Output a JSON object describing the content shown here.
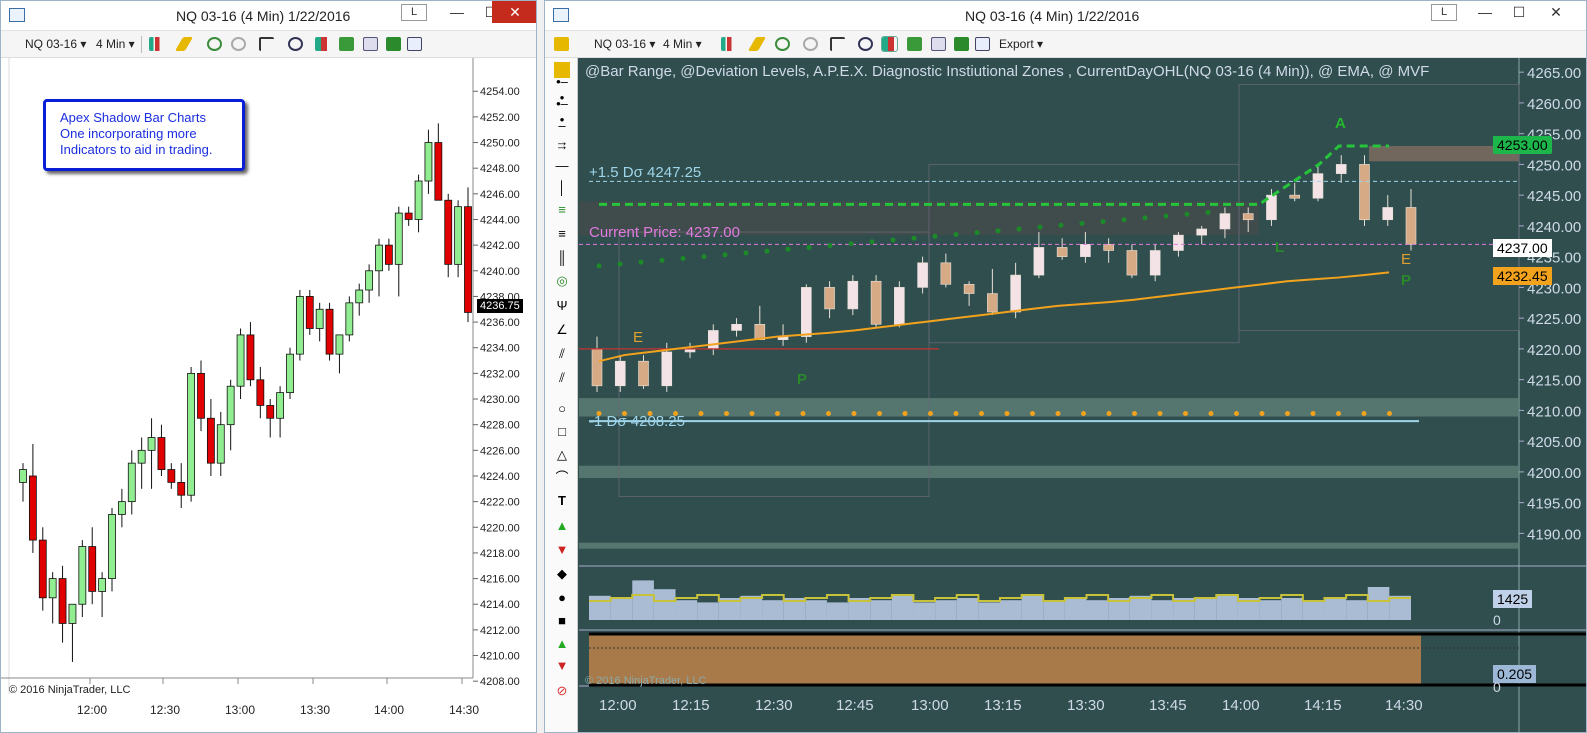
{
  "left_window": {
    "title": "NQ 03-16 (4 Min)  1/22/2016",
    "l_button": "L",
    "min_glyph": "—",
    "max_glyph": "☐",
    "close_glyph": "✕",
    "instrument": "NQ 03-16",
    "interval": "4 Min",
    "callout": [
      "Apex Shadow Bar Charts",
      "One incorporating more",
      "Indicators to aid in trading."
    ],
    "price_label": "4236.75",
    "copyright": "© 2016 NinjaTrader, LLC",
    "y_ticks": [
      "4254.00",
      "4252.00",
      "4250.00",
      "4248.00",
      "4246.00",
      "4244.00",
      "4242.00",
      "4240.00",
      "4238.00",
      "4236.00",
      "4234.00",
      "4232.00",
      "4230.00",
      "4228.00",
      "4226.00",
      "4224.00",
      "4222.00",
      "4220.00",
      "4218.00",
      "4216.00",
      "4214.00",
      "4212.00",
      "4210.00",
      "4208.00"
    ],
    "x_ticks": [
      "12:00",
      "12:30",
      "13:00",
      "13:30",
      "14:00",
      "14:30"
    ]
  },
  "right_window": {
    "title": "NQ 03-16 (4 Min)  1/22/2016",
    "l_button": "L",
    "min_glyph": "—",
    "max_glyph": "☐",
    "close_glyph": "✕",
    "instrument": "NQ 03-16",
    "interval": "4 Min",
    "export_label": "Export",
    "indicators_line": "@Bar Range, @Deviation Levels, A.P.E.X. Diagnostic Instiutional Zones , CurrentDayOHL(NQ 03-16 (4 Min)), @ EMA, @ MVF",
    "upper_dev_label": "+1.5 Dσ 4247.25",
    "lower_dev_label": "-1 Dσ 4208.25",
    "current_price_label": "Current Price: 4237.00",
    "y_ticks": [
      "4265.00",
      "4260.00",
      "4255.00",
      "4250.00",
      "4245.00",
      "4240.00",
      "4235.00",
      "4230.00",
      "4225.00",
      "4220.00",
      "4215.00",
      "4210.00",
      "4205.00",
      "4200.00",
      "4195.00",
      "4190.00"
    ],
    "x_ticks": [
      "12:00",
      "12:15",
      "12:30",
      "12:45",
      "13:00",
      "13:15",
      "13:30",
      "13:45",
      "14:00",
      "14:15",
      "14:30"
    ],
    "price_boxes": [
      "4253.00",
      "4237.00",
      "4232.45"
    ],
    "volume_box": "1425",
    "volume_zero": "0",
    "osc_box": "0.205",
    "osc_zero": "0",
    "copyright": "© 2016 NinjaTrader, LLC",
    "markers": {
      "A": "A",
      "E": "E",
      "P": "P",
      "L": "L"
    }
  },
  "left_chart_data": {
    "type": "candlestick",
    "ylim": [
      4207,
      4255.5
    ],
    "candles": [
      {
        "o": 4223.5,
        "h": 4225,
        "l": 4222,
        "c": 4224.5
      },
      {
        "o": 4224,
        "h": 4226.5,
        "l": 4218,
        "c": 4219
      },
      {
        "o": 4219,
        "h": 4220,
        "l": 4213.5,
        "c": 4214.5
      },
      {
        "o": 4214.5,
        "h": 4216.5,
        "l": 4212.5,
        "c": 4216
      },
      {
        "o": 4216,
        "h": 4217,
        "l": 4211,
        "c": 4212.5
      },
      {
        "o": 4212.5,
        "h": 4214,
        "l": 4209.5,
        "c": 4214
      },
      {
        "o": 4214,
        "h": 4219,
        "l": 4213,
        "c": 4218.5
      },
      {
        "o": 4218.5,
        "h": 4220,
        "l": 4214,
        "c": 4215
      },
      {
        "o": 4215,
        "h": 4216.5,
        "l": 4213,
        "c": 4216
      },
      {
        "o": 4216,
        "h": 4221.5,
        "l": 4215,
        "c": 4221
      },
      {
        "o": 4221,
        "h": 4223,
        "l": 4220,
        "c": 4222
      },
      {
        "o": 4222,
        "h": 4226,
        "l": 4221,
        "c": 4225
      },
      {
        "o": 4225,
        "h": 4227,
        "l": 4223,
        "c": 4226
      },
      {
        "o": 4226,
        "h": 4228.5,
        "l": 4223,
        "c": 4227
      },
      {
        "o": 4227,
        "h": 4228,
        "l": 4224,
        "c": 4224.5
      },
      {
        "o": 4224.5,
        "h": 4225,
        "l": 4223,
        "c": 4223.5
      },
      {
        "o": 4223.5,
        "h": 4225,
        "l": 4221.5,
        "c": 4222.5
      },
      {
        "o": 4222.5,
        "h": 4232.5,
        "l": 4222,
        "c": 4232
      },
      {
        "o": 4232,
        "h": 4233,
        "l": 4227.5,
        "c": 4228.5
      },
      {
        "o": 4228.5,
        "h": 4230,
        "l": 4224,
        "c": 4225
      },
      {
        "o": 4225,
        "h": 4229,
        "l": 4224,
        "c": 4228
      },
      {
        "o": 4228,
        "h": 4231.5,
        "l": 4226,
        "c": 4231
      },
      {
        "o": 4231,
        "h": 4235.5,
        "l": 4230,
        "c": 4235
      },
      {
        "o": 4235,
        "h": 4236,
        "l": 4231,
        "c": 4231.5
      },
      {
        "o": 4231.5,
        "h": 4232.5,
        "l": 4228.5,
        "c": 4229.5
      },
      {
        "o": 4229.5,
        "h": 4230,
        "l": 4227,
        "c": 4228.5
      },
      {
        "o": 4228.5,
        "h": 4231,
        "l": 4227,
        "c": 4230.5
      },
      {
        "o": 4230.5,
        "h": 4234,
        "l": 4230,
        "c": 4233.5
      },
      {
        "o": 4233.5,
        "h": 4238.5,
        "l": 4233,
        "c": 4238
      },
      {
        "o": 4238,
        "h": 4238.5,
        "l": 4235,
        "c": 4235.5
      },
      {
        "o": 4235.5,
        "h": 4237.5,
        "l": 4234.5,
        "c": 4237
      },
      {
        "o": 4237,
        "h": 4237.5,
        "l": 4233,
        "c": 4233.5
      },
      {
        "o": 4233.5,
        "h": 4235,
        "l": 4232,
        "c": 4235
      },
      {
        "o": 4235,
        "h": 4238,
        "l": 4234.5,
        "c": 4237.5
      },
      {
        "o": 4237.5,
        "h": 4239,
        "l": 4236.5,
        "c": 4238.5
      },
      {
        "o": 4238.5,
        "h": 4240.5,
        "l": 4237.5,
        "c": 4240
      },
      {
        "o": 4240,
        "h": 4242.5,
        "l": 4238,
        "c": 4242
      },
      {
        "o": 4242,
        "h": 4242.5,
        "l": 4240,
        "c": 4240.5
      },
      {
        "o": 4240.5,
        "h": 4245,
        "l": 4238,
        "c": 4244.5
      },
      {
        "o": 4244.5,
        "h": 4245,
        "l": 4243.5,
        "c": 4244
      },
      {
        "o": 4244,
        "h": 4247.5,
        "l": 4243,
        "c": 4247
      },
      {
        "o": 4247,
        "h": 4251,
        "l": 4246,
        "c": 4250
      },
      {
        "o": 4250,
        "h": 4251.5,
        "l": 4247,
        "c": 4245.5
      },
      {
        "o": 4245.5,
        "h": 4246,
        "l": 4239.5,
        "c": 4240.5
      },
      {
        "o": 4240.5,
        "h": 4245.5,
        "l": 4239.5,
        "c": 4245
      },
      {
        "o": 4245,
        "h": 4246.5,
        "l": 4236,
        "c": 4236.75
      }
    ]
  },
  "chart_data": {
    "type": "candlestick",
    "ylim": [
      4186,
      4266
    ],
    "ema": [
      4218,
      4219,
      4219.5,
      4220,
      4220.5,
      4221,
      4221.5,
      4222,
      4222.3,
      4222.6,
      4223,
      4223.5,
      4224,
      4224.5,
      4225,
      4225.5,
      4226,
      4226.5,
      4227,
      4227.3,
      4227.6,
      4228,
      4228.5,
      4229,
      4229.5,
      4230,
      4230.5,
      4231,
      4231.3,
      4231.6,
      4232,
      4232.45
    ],
    "candles": [
      {
        "o": 4220,
        "h": 4222,
        "l": 4213,
        "c": 4214
      },
      {
        "o": 4214,
        "h": 4219,
        "l": 4213,
        "c": 4218
      },
      {
        "o": 4218,
        "h": 4219,
        "l": 4213.5,
        "c": 4214
      },
      {
        "o": 4214,
        "h": 4221,
        "l": 4213,
        "c": 4219.5
      },
      {
        "o": 4219.5,
        "h": 4221,
        "l": 4218.5,
        "c": 4220
      },
      {
        "o": 4220,
        "h": 4224,
        "l": 4219,
        "c": 4223
      },
      {
        "o": 4223,
        "h": 4225,
        "l": 4222,
        "c": 4224
      },
      {
        "o": 4224,
        "h": 4227,
        "l": 4222,
        "c": 4221.5
      },
      {
        "o": 4221.5,
        "h": 4224,
        "l": 4220.5,
        "c": 4222
      },
      {
        "o": 4222,
        "h": 4230.5,
        "l": 4221,
        "c": 4230
      },
      {
        "o": 4230,
        "h": 4231,
        "l": 4225,
        "c": 4226.5
      },
      {
        "o": 4226.5,
        "h": 4232,
        "l": 4225.5,
        "c": 4231
      },
      {
        "o": 4231,
        "h": 4232,
        "l": 4223.5,
        "c": 4224
      },
      {
        "o": 4224,
        "h": 4231,
        "l": 4223.5,
        "c": 4230
      },
      {
        "o": 4230,
        "h": 4235,
        "l": 4229,
        "c": 4234
      },
      {
        "o": 4234,
        "h": 4235.5,
        "l": 4230,
        "c": 4230.5
      },
      {
        "o": 4230.5,
        "h": 4231,
        "l": 4227,
        "c": 4229
      },
      {
        "o": 4229,
        "h": 4233,
        "l": 4225.5,
        "c": 4226
      },
      {
        "o": 4226,
        "h": 4234,
        "l": 4225,
        "c": 4232
      },
      {
        "o": 4232,
        "h": 4239,
        "l": 4231.5,
        "c": 4236.5
      },
      {
        "o": 4236.5,
        "h": 4238,
        "l": 4234.5,
        "c": 4235
      },
      {
        "o": 4235,
        "h": 4239,
        "l": 4234,
        "c": 4237
      },
      {
        "o": 4237,
        "h": 4238,
        "l": 4234,
        "c": 4236
      },
      {
        "o": 4236,
        "h": 4237,
        "l": 4231.5,
        "c": 4232
      },
      {
        "o": 4232,
        "h": 4237,
        "l": 4231,
        "c": 4236
      },
      {
        "o": 4236,
        "h": 4239,
        "l": 4235,
        "c": 4238.5
      },
      {
        "o": 4238.5,
        "h": 4240,
        "l": 4237,
        "c": 4239.5
      },
      {
        "o": 4239.5,
        "h": 4243,
        "l": 4238,
        "c": 4242
      },
      {
        "o": 4242,
        "h": 4243,
        "l": 4239,
        "c": 4241
      },
      {
        "o": 4241,
        "h": 4246,
        "l": 4240,
        "c": 4245
      },
      {
        "o": 4245,
        "h": 4247,
        "l": 4244,
        "c": 4244.5
      },
      {
        "o": 4244.5,
        "h": 4250,
        "l": 4244,
        "c": 4248.5
      },
      {
        "o": 4248.5,
        "h": 4251.5,
        "l": 4247,
        "c": 4250
      },
      {
        "o": 4250,
        "h": 4251.5,
        "l": 4240,
        "c": 4241
      },
      {
        "o": 4241,
        "h": 4245,
        "l": 4240,
        "c": 4243
      },
      {
        "o": 4243,
        "h": 4246,
        "l": 4236,
        "c": 4237
      }
    ],
    "volume": [
      0.55,
      0.5,
      0.9,
      0.7,
      0.45,
      0.4,
      0.5,
      0.55,
      0.45,
      0.5,
      0.45,
      0.4,
      0.5,
      0.45,
      0.55,
      0.4,
      0.45,
      0.5,
      0.4,
      0.45,
      0.55,
      0.45,
      0.5,
      0.45,
      0.5,
      0.55,
      0.45,
      0.5,
      0.5,
      0.55,
      0.5,
      0.45,
      0.5,
      0.45,
      0.5,
      0.45,
      0.75,
      0.55
    ]
  },
  "toolbar_icons": [
    "bars-icon",
    "pencil-icon",
    "crosshair-icon",
    "zoom-icon",
    "chart-style-icon",
    "properties-icon",
    "dollar-icon",
    "data-box-icon"
  ]
}
